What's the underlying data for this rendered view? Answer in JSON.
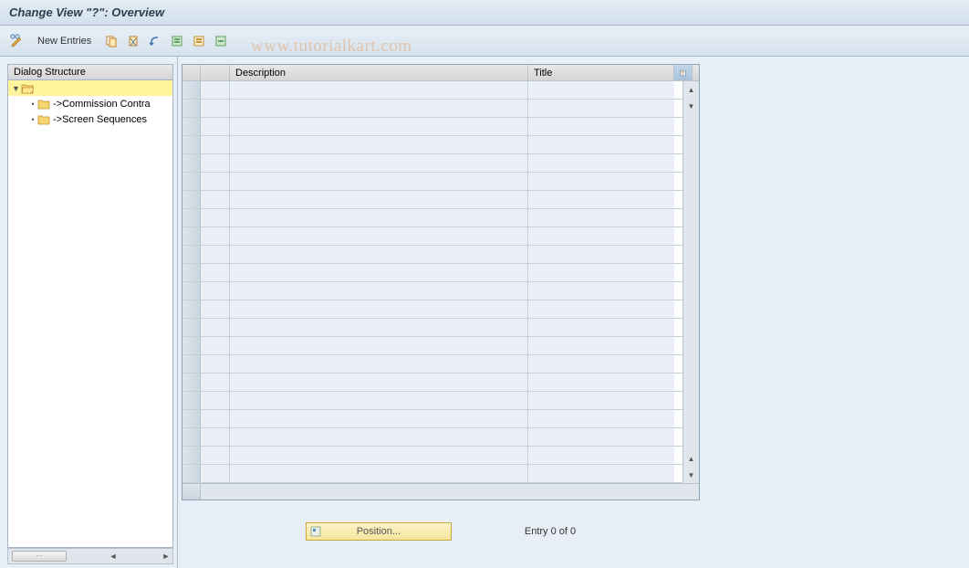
{
  "title": "Change View \"?\": Overview",
  "toolbar": {
    "new_entries_label": "New Entries"
  },
  "dialog_structure": {
    "header": "Dialog Structure",
    "items": [
      {
        "label": "",
        "level": 1,
        "expanded": true,
        "selected": true,
        "folder": "open"
      },
      {
        "label": "->Commission Contra",
        "level": 2,
        "folder": "closed"
      },
      {
        "label": "->Screen Sequences",
        "level": 2,
        "folder": "closed"
      }
    ]
  },
  "table": {
    "columns": {
      "description": "Description",
      "title": "Title"
    },
    "rows_visible": 22
  },
  "position_button_label": "Position...",
  "entry_status": "Entry 0 of 0",
  "watermark": "www.tutorialkart.com"
}
